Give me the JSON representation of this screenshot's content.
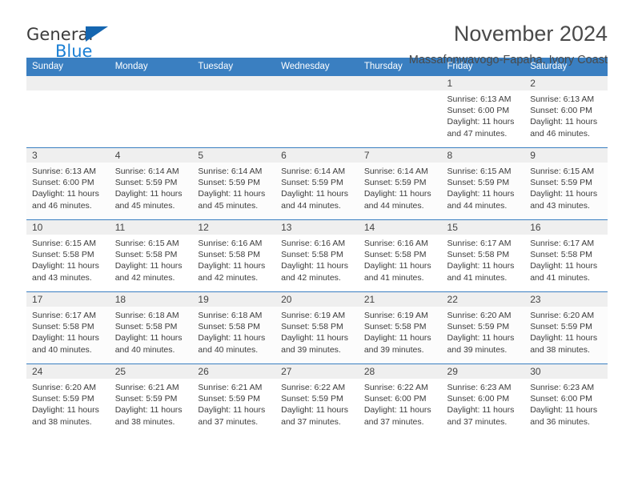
{
  "brand": {
    "name_part1": "General",
    "name_part2": "Blue",
    "flag_icon": "blue-triangle-flag-icon"
  },
  "header": {
    "title": "November 2024",
    "subtitle": "Massafonwavogo-Fapaha, Ivory Coast"
  },
  "colors": {
    "header_blue": "#3a7fc1",
    "brand_blue": "#1a7fd4",
    "daynum_band": "#efefef",
    "text": "#3c3c3c"
  },
  "weekdays": [
    "Sunday",
    "Monday",
    "Tuesday",
    "Wednesday",
    "Thursday",
    "Friday",
    "Saturday"
  ],
  "weeks": [
    [
      {
        "day": "",
        "blank": true,
        "lines": []
      },
      {
        "day": "",
        "blank": true,
        "lines": []
      },
      {
        "day": "",
        "blank": true,
        "lines": []
      },
      {
        "day": "",
        "blank": true,
        "lines": []
      },
      {
        "day": "",
        "blank": true,
        "lines": []
      },
      {
        "day": "1",
        "blank": false,
        "lines": [
          "Sunrise: 6:13 AM",
          "Sunset: 6:00 PM",
          "Daylight: 11 hours",
          "and 47 minutes."
        ]
      },
      {
        "day": "2",
        "blank": false,
        "lines": [
          "Sunrise: 6:13 AM",
          "Sunset: 6:00 PM",
          "Daylight: 11 hours",
          "and 46 minutes."
        ]
      }
    ],
    [
      {
        "day": "3",
        "blank": false,
        "lines": [
          "Sunrise: 6:13 AM",
          "Sunset: 6:00 PM",
          "Daylight: 11 hours",
          "and 46 minutes."
        ]
      },
      {
        "day": "4",
        "blank": false,
        "lines": [
          "Sunrise: 6:14 AM",
          "Sunset: 5:59 PM",
          "Daylight: 11 hours",
          "and 45 minutes."
        ]
      },
      {
        "day": "5",
        "blank": false,
        "lines": [
          "Sunrise: 6:14 AM",
          "Sunset: 5:59 PM",
          "Daylight: 11 hours",
          "and 45 minutes."
        ]
      },
      {
        "day": "6",
        "blank": false,
        "lines": [
          "Sunrise: 6:14 AM",
          "Sunset: 5:59 PM",
          "Daylight: 11 hours",
          "and 44 minutes."
        ]
      },
      {
        "day": "7",
        "blank": false,
        "lines": [
          "Sunrise: 6:14 AM",
          "Sunset: 5:59 PM",
          "Daylight: 11 hours",
          "and 44 minutes."
        ]
      },
      {
        "day": "8",
        "blank": false,
        "lines": [
          "Sunrise: 6:15 AM",
          "Sunset: 5:59 PM",
          "Daylight: 11 hours",
          "and 44 minutes."
        ]
      },
      {
        "day": "9",
        "blank": false,
        "lines": [
          "Sunrise: 6:15 AM",
          "Sunset: 5:59 PM",
          "Daylight: 11 hours",
          "and 43 minutes."
        ]
      }
    ],
    [
      {
        "day": "10",
        "blank": false,
        "lines": [
          "Sunrise: 6:15 AM",
          "Sunset: 5:58 PM",
          "Daylight: 11 hours",
          "and 43 minutes."
        ]
      },
      {
        "day": "11",
        "blank": false,
        "lines": [
          "Sunrise: 6:15 AM",
          "Sunset: 5:58 PM",
          "Daylight: 11 hours",
          "and 42 minutes."
        ]
      },
      {
        "day": "12",
        "blank": false,
        "lines": [
          "Sunrise: 6:16 AM",
          "Sunset: 5:58 PM",
          "Daylight: 11 hours",
          "and 42 minutes."
        ]
      },
      {
        "day": "13",
        "blank": false,
        "lines": [
          "Sunrise: 6:16 AM",
          "Sunset: 5:58 PM",
          "Daylight: 11 hours",
          "and 42 minutes."
        ]
      },
      {
        "day": "14",
        "blank": false,
        "lines": [
          "Sunrise: 6:16 AM",
          "Sunset: 5:58 PM",
          "Daylight: 11 hours",
          "and 41 minutes."
        ]
      },
      {
        "day": "15",
        "blank": false,
        "lines": [
          "Sunrise: 6:17 AM",
          "Sunset: 5:58 PM",
          "Daylight: 11 hours",
          "and 41 minutes."
        ]
      },
      {
        "day": "16",
        "blank": false,
        "lines": [
          "Sunrise: 6:17 AM",
          "Sunset: 5:58 PM",
          "Daylight: 11 hours",
          "and 41 minutes."
        ]
      }
    ],
    [
      {
        "day": "17",
        "blank": false,
        "lines": [
          "Sunrise: 6:17 AM",
          "Sunset: 5:58 PM",
          "Daylight: 11 hours",
          "and 40 minutes."
        ]
      },
      {
        "day": "18",
        "blank": false,
        "lines": [
          "Sunrise: 6:18 AM",
          "Sunset: 5:58 PM",
          "Daylight: 11 hours",
          "and 40 minutes."
        ]
      },
      {
        "day": "19",
        "blank": false,
        "lines": [
          "Sunrise: 6:18 AM",
          "Sunset: 5:58 PM",
          "Daylight: 11 hours",
          "and 40 minutes."
        ]
      },
      {
        "day": "20",
        "blank": false,
        "lines": [
          "Sunrise: 6:19 AM",
          "Sunset: 5:58 PM",
          "Daylight: 11 hours",
          "and 39 minutes."
        ]
      },
      {
        "day": "21",
        "blank": false,
        "lines": [
          "Sunrise: 6:19 AM",
          "Sunset: 5:58 PM",
          "Daylight: 11 hours",
          "and 39 minutes."
        ]
      },
      {
        "day": "22",
        "blank": false,
        "lines": [
          "Sunrise: 6:20 AM",
          "Sunset: 5:59 PM",
          "Daylight: 11 hours",
          "and 39 minutes."
        ]
      },
      {
        "day": "23",
        "blank": false,
        "lines": [
          "Sunrise: 6:20 AM",
          "Sunset: 5:59 PM",
          "Daylight: 11 hours",
          "and 38 minutes."
        ]
      }
    ],
    [
      {
        "day": "24",
        "blank": false,
        "lines": [
          "Sunrise: 6:20 AM",
          "Sunset: 5:59 PM",
          "Daylight: 11 hours",
          "and 38 minutes."
        ]
      },
      {
        "day": "25",
        "blank": false,
        "lines": [
          "Sunrise: 6:21 AM",
          "Sunset: 5:59 PM",
          "Daylight: 11 hours",
          "and 38 minutes."
        ]
      },
      {
        "day": "26",
        "blank": false,
        "lines": [
          "Sunrise: 6:21 AM",
          "Sunset: 5:59 PM",
          "Daylight: 11 hours",
          "and 37 minutes."
        ]
      },
      {
        "day": "27",
        "blank": false,
        "lines": [
          "Sunrise: 6:22 AM",
          "Sunset: 5:59 PM",
          "Daylight: 11 hours",
          "and 37 minutes."
        ]
      },
      {
        "day": "28",
        "blank": false,
        "lines": [
          "Sunrise: 6:22 AM",
          "Sunset: 6:00 PM",
          "Daylight: 11 hours",
          "and 37 minutes."
        ]
      },
      {
        "day": "29",
        "blank": false,
        "lines": [
          "Sunrise: 6:23 AM",
          "Sunset: 6:00 PM",
          "Daylight: 11 hours",
          "and 37 minutes."
        ]
      },
      {
        "day": "30",
        "blank": false,
        "lines": [
          "Sunrise: 6:23 AM",
          "Sunset: 6:00 PM",
          "Daylight: 11 hours",
          "and 36 minutes."
        ]
      }
    ]
  ]
}
